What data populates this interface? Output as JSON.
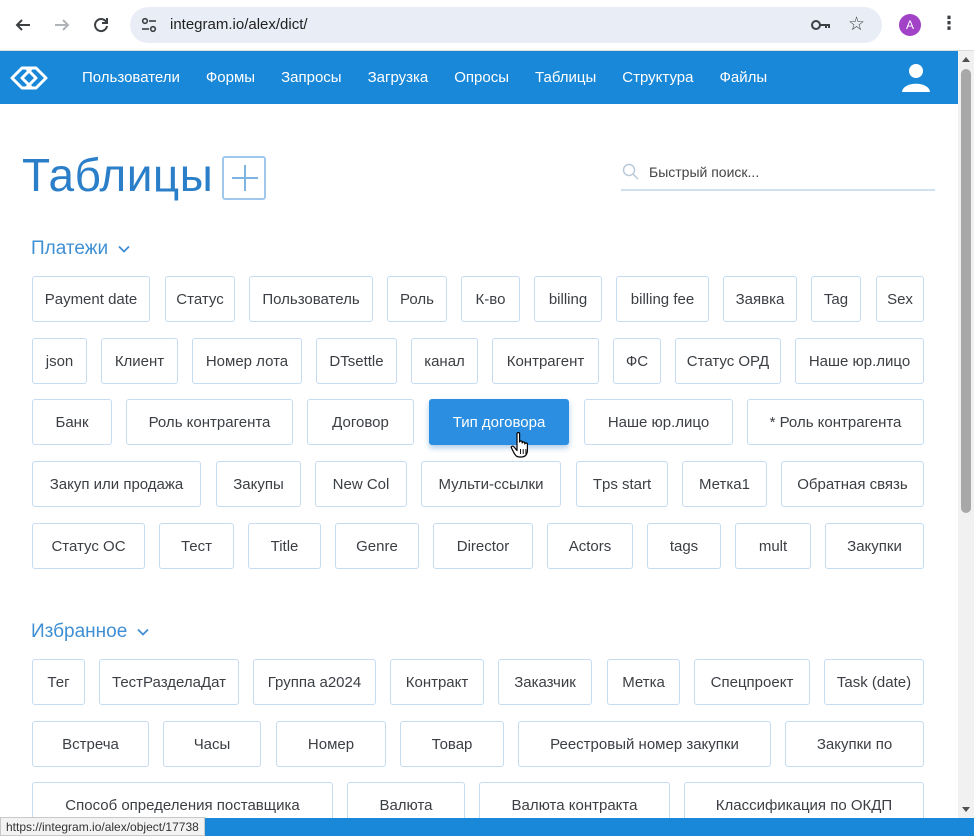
{
  "browser": {
    "url": "integram.io/alex/dict/",
    "profile_initial": "A",
    "icons": [
      "back-arrow-icon",
      "forward-arrow-icon",
      "reload-icon",
      "site-settings-icon",
      "key-icon",
      "star-icon",
      "kebab-menu-icon"
    ]
  },
  "navbar": {
    "items": [
      "Пользователи",
      "Формы",
      "Запросы",
      "Загрузка",
      "Опросы",
      "Таблицы",
      "Структура",
      "Файлы"
    ],
    "accent": "#1a88d8"
  },
  "page": {
    "title": "Таблицы",
    "search_placeholder": "Быстрый поиск..."
  },
  "sections": {
    "payments": {
      "title": "Платежи",
      "chips": [
        "Payment date",
        "Статус",
        "Пользователь",
        "Роль",
        "К-во",
        "billing",
        "billing fee",
        "Заявка",
        "Tag",
        "Sex",
        "json",
        "Клиент",
        "Номер лота",
        "DTsettle",
        "канал",
        "Контрагент",
        "ФС",
        "Статус ОРД",
        "Наше юр.лицо",
        "Банк",
        "Роль контрагента",
        "Договор",
        "Тип договора",
        "Наше юр.лицо",
        "* Роль контрагента",
        "Закуп или продажа",
        "Закупы",
        "New Col",
        "Мульти-ссылки",
        "Tps start",
        "Метка1",
        "Обратная связь",
        "Статус ОС",
        "Тест",
        "Title",
        "Genre",
        "Director",
        "Actors",
        "tags",
        "mult",
        "Закупки"
      ],
      "active": "Тип договора"
    },
    "favorites": {
      "title": "Избранное",
      "chips": [
        "Тег",
        "ТестРазделаДат",
        "Группа а2024",
        "Контракт",
        "Заказчик",
        "Метка",
        "Спецпроект",
        "Task (date)",
        "Встреча",
        "Часы",
        "Номер",
        "Товар",
        "Реестровый номер закупки",
        "Закупки по",
        "Способ определения поставщика",
        "Валюта",
        "Валюта контракта",
        "Классификация по ОКДП"
      ]
    }
  },
  "status": {
    "hover_url": "https://integram.io/alex/object/17738"
  },
  "colors": {
    "chip_border": "#c6dcf2",
    "active_chip": "#2b8ee0",
    "title": "#2b7fc9"
  }
}
